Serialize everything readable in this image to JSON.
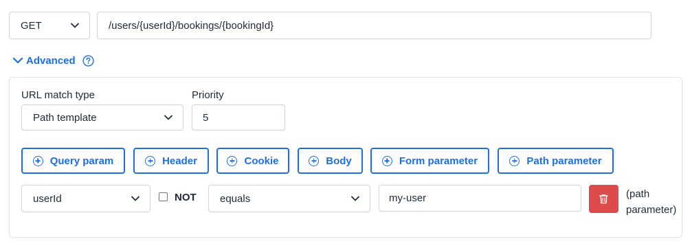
{
  "request": {
    "method": "GET",
    "url": "/users/{userId}/bookings/{bookingId}"
  },
  "advanced": {
    "label": "Advanced",
    "help_icon": "question-circle-icon"
  },
  "match": {
    "url_match_type_label": "URL match type",
    "url_match_type_value": "Path template",
    "priority_label": "Priority",
    "priority_value": "5"
  },
  "add_buttons": [
    {
      "label": "Query param"
    },
    {
      "label": "Header"
    },
    {
      "label": "Cookie"
    },
    {
      "label": "Body"
    },
    {
      "label": "Form parameter"
    },
    {
      "label": "Path parameter"
    }
  ],
  "path_param_row": {
    "name": "userId",
    "not_label": "NOT",
    "not_checked": false,
    "operator": "equals",
    "value": "my-user",
    "note": "(path parameter)"
  },
  "colors": {
    "accent": "#1d6ee5",
    "danger": "#dd4b4b"
  }
}
